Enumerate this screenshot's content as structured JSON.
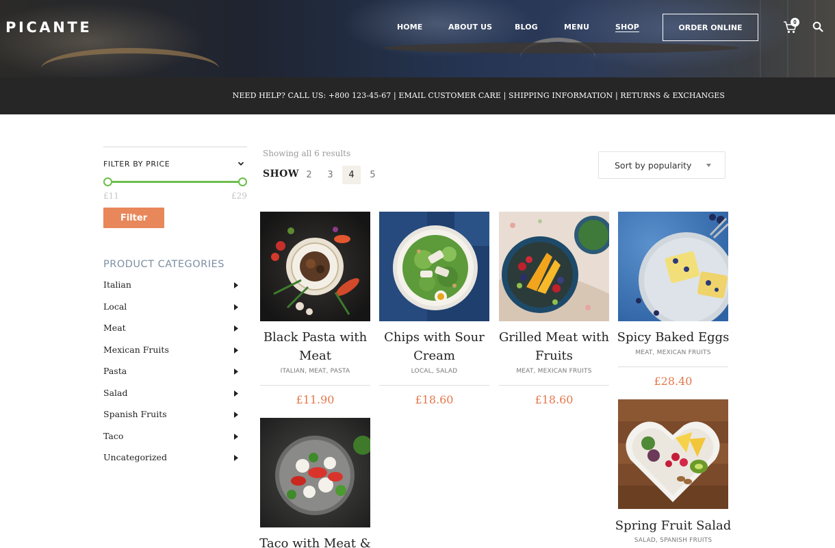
{
  "brand": {
    "logo": "PICANTE"
  },
  "nav": {
    "items": [
      {
        "label": "HOME"
      },
      {
        "label": "ABOUT US"
      },
      {
        "label": "BLOG"
      },
      {
        "label": "MENU"
      },
      {
        "label": "SHOP",
        "active": true
      }
    ],
    "order_button": "ORDER ONLINE",
    "cart_count": "0",
    "icons": [
      "cart-icon",
      "search-icon"
    ]
  },
  "infobar": {
    "text": "NEED HELP? CALL US: +800 123-45-67 | EMAIL CUSTOMER CARE | SHIPPING INFORMATION | RETURNS & EXCHANGES"
  },
  "sidebar": {
    "filter": {
      "title": "FILTER BY PRICE",
      "min_label": "£11",
      "max_label": "£29",
      "button": "Filter"
    },
    "categories": {
      "heading": "PRODUCT CATEGORIES",
      "items": [
        {
          "label": "Italian"
        },
        {
          "label": "Local"
        },
        {
          "label": "Meat"
        },
        {
          "label": "Mexican Fruits"
        },
        {
          "label": "Pasta"
        },
        {
          "label": "Salad"
        },
        {
          "label": "Spanish Fruits"
        },
        {
          "label": "Taco"
        },
        {
          "label": "Uncategorized"
        }
      ]
    }
  },
  "toolbar": {
    "results": "Showing all 6 results",
    "show_label": "SHOW",
    "show_options": [
      "2",
      "3",
      "4",
      "5"
    ],
    "show_selected": "4",
    "sort": "Sort by popularity"
  },
  "products": [
    {
      "name_lines": [
        "Black Pasta with",
        "Meat"
      ],
      "categories": "ITALIAN, MEAT, PASTA",
      "price": "£11.90"
    },
    {
      "name_lines": [
        "Chips with Sour",
        "Cream"
      ],
      "categories": "LOCAL, SALAD",
      "price": "£18.60"
    },
    {
      "name_lines": [
        "Grilled Meat with",
        "Fruits"
      ],
      "categories": "MEAT, MEXICAN FRUITS",
      "price": "£18.60"
    },
    {
      "name_lines": [
        "Spicy Baked Eggs"
      ],
      "categories": "MEAT, MEXICAN FRUITS",
      "price": "£28.40"
    },
    {
      "name_lines": [
        "Taco with Meat &"
      ],
      "categories": "",
      "price": ""
    },
    {
      "name_lines": [
        "Spring Fruit Salad"
      ],
      "categories": "SALAD, SPANISH FRUITS",
      "price": ""
    }
  ]
}
